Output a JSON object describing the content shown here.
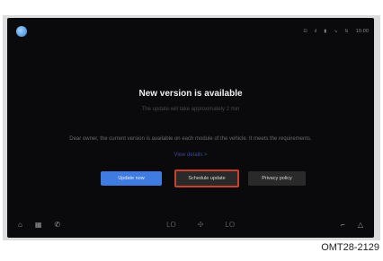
{
  "status_bar": {
    "items": [
      "⊡",
      "ıl",
      "▮",
      "↘",
      "⇅",
      "10:00"
    ]
  },
  "dialog": {
    "title": "New version is available",
    "subtitle": "The update will take approximately 2 min",
    "message": "Dear owner, the current version is available on each module of the vehicle. It meets the requirements.",
    "details_link": "View details >",
    "buttons": {
      "update_now": "Update now",
      "schedule_update": "Schedule update",
      "privacy_policy": "Privacy policy"
    }
  },
  "bottom_nav": {
    "left_icons": [
      "home-icon",
      "apps-icon",
      "phone-icon"
    ],
    "center_left": "LO",
    "center_right": "LO"
  },
  "caption": "OMT28-2129",
  "colors": {
    "screen_bg": "#0a0a0c",
    "primary_button": "#3f7be0",
    "highlight_border": "#c9402c"
  }
}
